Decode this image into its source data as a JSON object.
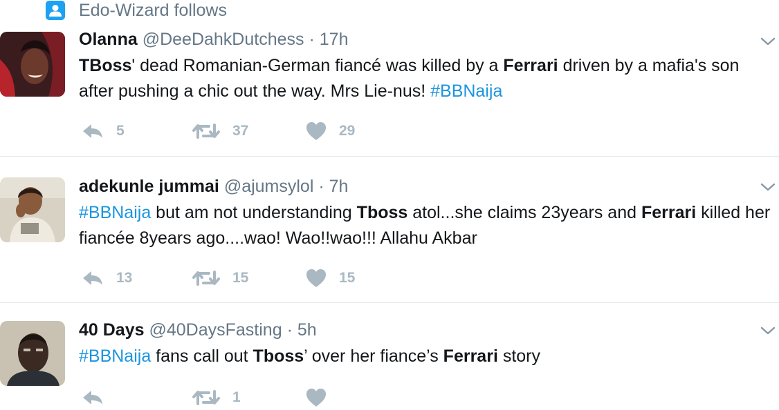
{
  "context": {
    "label": "Edo-Wizard follows",
    "icon": "person-icon"
  },
  "tweets": [
    {
      "name": "Olanna",
      "handle": "@DeeDahkDutchess",
      "dot": "·",
      "time": "17h",
      "text": [
        {
          "t": "TBoss",
          "b": true
        },
        {
          "t": "' dead Romanian-German fiancé was killed by a "
        },
        {
          "t": "Ferrari",
          "b": true
        },
        {
          "t": " driven by a mafia's son after pushing a chic out the way. Mrs Lie-nus! "
        },
        {
          "t": "#BBNaija",
          "tag": true
        }
      ],
      "reply_count": "5",
      "retweet_count": "37",
      "like_count": "29"
    },
    {
      "name": "adekunle jummai",
      "handle": "@ajumsylol",
      "dot": "·",
      "time": "7h",
      "text": [
        {
          "t": "#BBNaija",
          "tag": true
        },
        {
          "t": " but am not understanding "
        },
        {
          "t": "Tboss",
          "b": true
        },
        {
          "t": " atol...she claims 23years and "
        },
        {
          "t": "Ferrari",
          "b": true
        },
        {
          "t": " killed her fiancée 8years ago....wao! Wao!!wao!!! Allahu Akbar"
        }
      ],
      "reply_count": "13",
      "retweet_count": "15",
      "like_count": "15"
    },
    {
      "name": "40 Days",
      "handle": "@40DaysFasting",
      "dot": "·",
      "time": "5h",
      "text": [
        {
          "t": "#BBNaija",
          "tag": true
        },
        {
          "t": " fans call out "
        },
        {
          "t": "Tboss",
          "b": true
        },
        {
          "t": "’ over her fiance’s "
        },
        {
          "t": "Ferrari",
          "b": true
        },
        {
          "t": " story"
        }
      ],
      "reply_count": "",
      "retweet_count": "1",
      "like_count": ""
    }
  ],
  "colors": {
    "hashtag": "#1b95e0",
    "muted": "#657786",
    "action": "#aab8c2",
    "context_icon": "#1da1f2"
  }
}
